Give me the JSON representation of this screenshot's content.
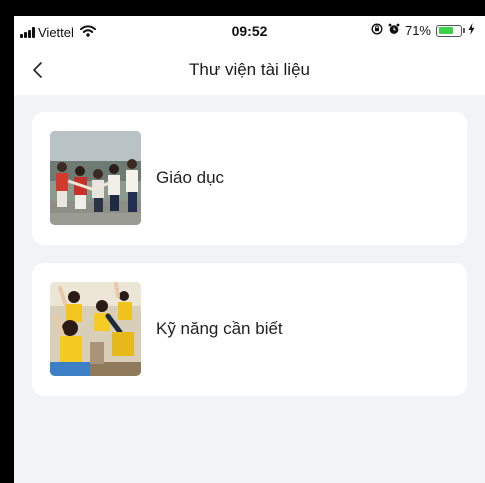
{
  "status_bar": {
    "carrier": "Viettel",
    "time": "09:52",
    "battery": "71%",
    "battery_level": 0.71,
    "icons": [
      "signal-icon",
      "wifi-icon",
      "orientation-lock-icon",
      "alarm-icon",
      "battery-icon",
      "charging-bolt-icon"
    ]
  },
  "header": {
    "title": "Thư viện tài liệu",
    "back_icon": "chevron-left-icon"
  },
  "categories": [
    {
      "label": "Giáo dục",
      "thumbnail": "children-playing-photo"
    },
    {
      "label": "Kỹ năng cần biết",
      "thumbnail": "children-in-classroom-photo"
    }
  ],
  "colors": {
    "background": "#f2f3f5",
    "card": "#ffffff",
    "battery_fill": "#3fd14a",
    "text": "#1a1a1a"
  }
}
